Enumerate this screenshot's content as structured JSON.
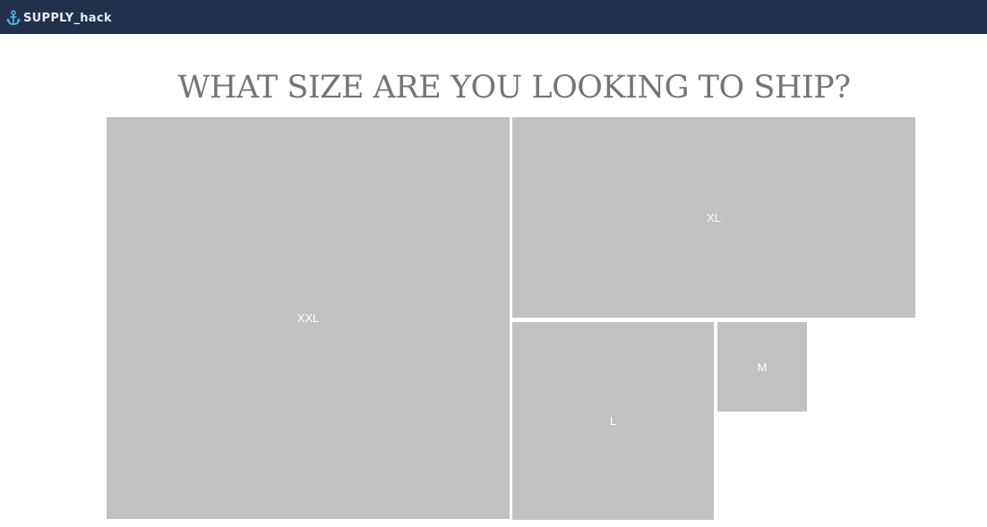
{
  "header": {
    "brand": "SUPPLY_hack",
    "brand_icon": "anchor-icon",
    "background_color": "#22304d"
  },
  "main": {
    "title": "WHAT SIZE ARE YOU LOOKING TO SHIP?",
    "box_color": "#c1c1c1",
    "sizes": [
      {
        "label": "XXL"
      },
      {
        "label": "XL"
      },
      {
        "label": "L"
      },
      {
        "label": "M"
      }
    ]
  }
}
